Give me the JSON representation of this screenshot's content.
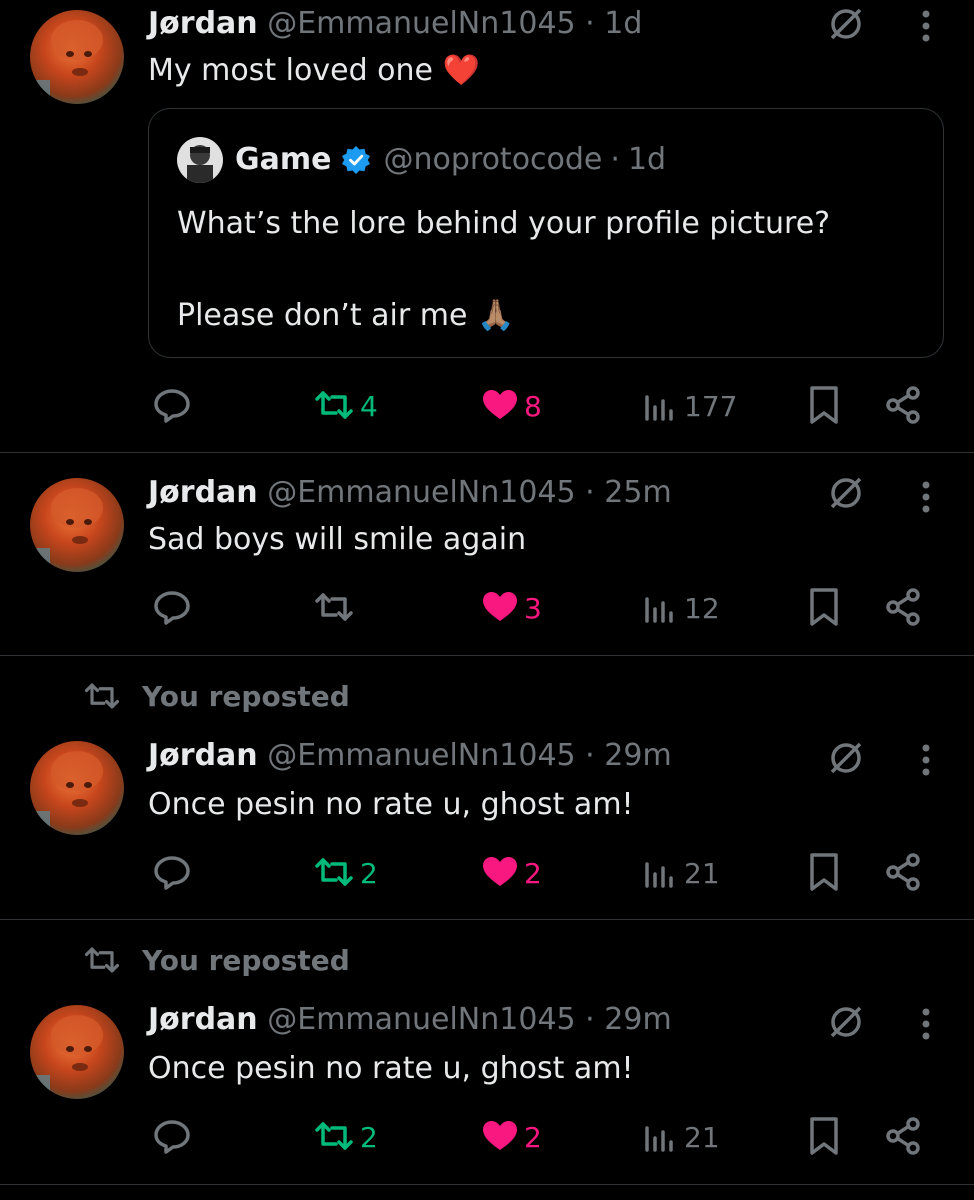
{
  "tweets": [
    {
      "name": "Jørdan",
      "handle": "@EmmanuelNn1045",
      "dot": "·",
      "time": "1d",
      "text": "My most loved one",
      "emoji": "❤️",
      "quote": {
        "name": "Game",
        "handle": "@noprotocode",
        "dot": "·",
        "time": "1d",
        "line1": "What’s the lore behind your profile picture?",
        "line2": "Please don’t air me",
        "emoji": "🙏🏽"
      },
      "reposts": "4",
      "likes": "8",
      "views": "177"
    },
    {
      "name": "Jørdan",
      "handle": "@EmmanuelNn1045",
      "dot": "·",
      "time": "25m",
      "text": "Sad boys will smile again",
      "reposts": "",
      "likes": "3",
      "views": "12"
    },
    {
      "repost_label": "You reposted",
      "name": "Jørdan",
      "handle": "@EmmanuelNn1045",
      "dot": "·",
      "time": "29m",
      "text": "Once pesin no rate u, ghost am!",
      "reposts": "2",
      "likes": "2",
      "views": "21"
    },
    {
      "repost_label": "You reposted",
      "name": "Jørdan",
      "handle": "@EmmanuelNn1045",
      "dot": "·",
      "time": "29m",
      "text": "Once pesin no rate u, ghost am!",
      "reposts": "2",
      "likes": "2",
      "views": "21"
    }
  ],
  "colors": {
    "background": "#000000",
    "text": "#e7e9ea",
    "muted": "#71767b",
    "repost_active": "#00ba7c",
    "like_active": "#f91880",
    "verified": "#1d9bf0",
    "divider": "#2f3336"
  },
  "icons": [
    "reply-icon",
    "repost-icon",
    "like-icon",
    "views-icon",
    "bookmark-icon",
    "share-icon",
    "grok-icon",
    "more-icon",
    "verified-icon"
  ]
}
